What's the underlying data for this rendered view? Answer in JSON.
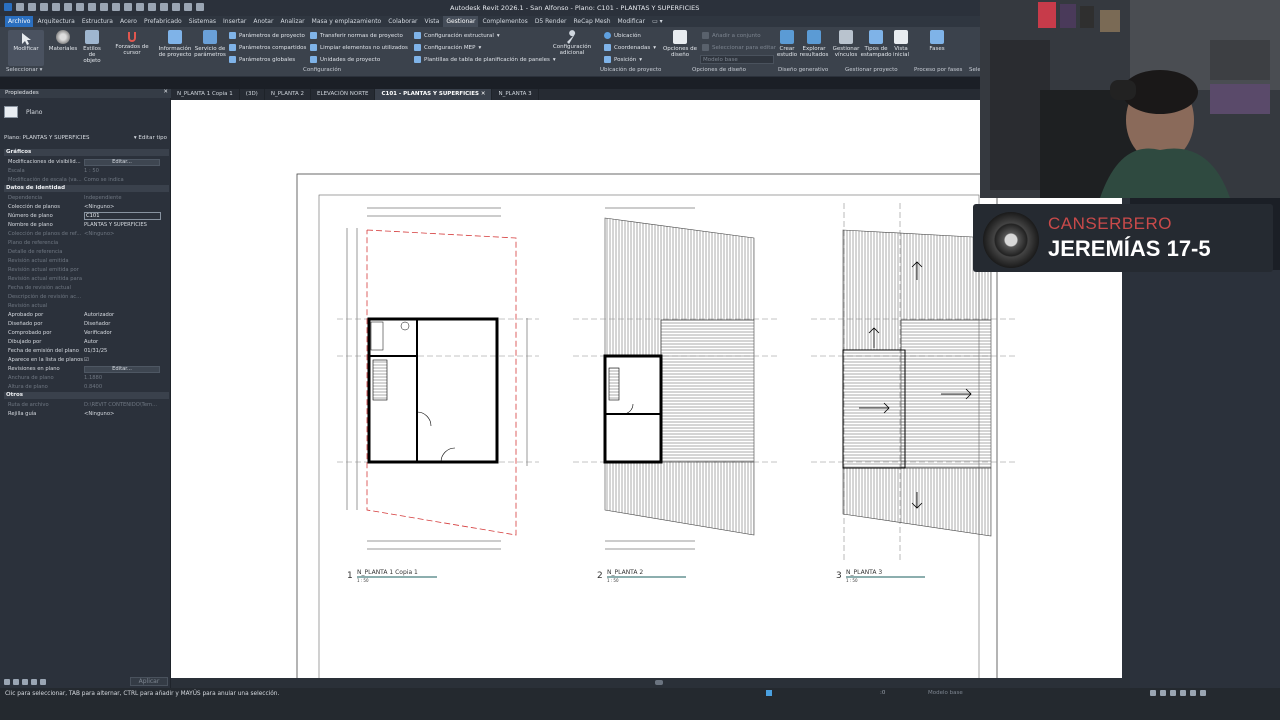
{
  "window_title": "Autodesk Revit 2026.1 - San Alfonso - Plano: C101 - PLANTAS Y SUPERFICIES",
  "menu_tabs": [
    "Archivo",
    "Arquitectura",
    "Estructura",
    "Acero",
    "Prefabricado",
    "Sistemas",
    "Insertar",
    "Anotar",
    "Analizar",
    "Masa y emplazamiento",
    "Colaborar",
    "Vista",
    "Gestionar",
    "Complementos",
    "D5 Render",
    "ReCap Mesh",
    "Modificar"
  ],
  "ribbon": {
    "modificar": "Modificar",
    "seleccionar": "Seleccionar",
    "materiales": "Materiales",
    "estilos_objeto": "Estilos de objeto",
    "forzados": "Forzados de cursor",
    "informacion": "Información de proyecto",
    "servicio": "Servicio de parámetros",
    "parametros_proyecto": "Parámetros de proyecto",
    "parametros_compartidos": "Parámetros compartidos",
    "parametros_globales": "Parámetros globales",
    "transferir": "Transferir normas de proyecto",
    "limpiar": "Limpiar elementos no utilizados",
    "unidades": "Unidades de proyecto",
    "config_estructural": "Configuración estructural",
    "config_mep": "Configuración MEP",
    "plantillas": "Plantillas de tabla de planificación de paneles",
    "configuracion": "Configuración",
    "config_adicional": "Configuración adicional",
    "ubicacion": "Ubicación",
    "coordenadas": "Coordenadas",
    "posicion": "Posición",
    "ubicacion_proyecto": "Ubicación de proyecto",
    "opciones_diseno_btn": "Opciones de diseño",
    "anadir_conjunto": "Añadir a conjunto",
    "seleccionar_edicion": "Seleccionar para editar",
    "modelo_base": "Modelo base",
    "opciones_diseno": "Opciones de diseño",
    "crear_estudio": "Crear estudio",
    "explorar": "Explorar resultados",
    "diseno_generativo": "Diseño generativo",
    "gestionar_vinculos": "Gestionar vínculos",
    "tipos_estampado": "Tipos de estampado",
    "vista_inicial": "Vista inicial",
    "gestionar_proyecto": "Gestionar proyecto",
    "fases": "Fases",
    "proceso_fases": "Proceso por fases",
    "sel": "Sele"
  },
  "properties": {
    "title": "Propiedades",
    "type_name": "Plano",
    "selector": "Plano: PLANTAS Y SUPERFICIES",
    "edit_type": "Editar tipo",
    "section_graficos": "Gráficos",
    "section_identidad": "Datos de identidad",
    "section_otros": "Otros",
    "graficos": [
      {
        "k": "Modificaciones de visibilid...",
        "v": "Editar...",
        "button": true
      },
      {
        "k": "Escala",
        "v": "1 : 50",
        "dim": true
      },
      {
        "k": "Modificación de escala (va...",
        "v": "Como se indica",
        "dim": true
      }
    ],
    "identidad": [
      {
        "k": "Dependencia",
        "v": "Independiente",
        "dim": true
      },
      {
        "k": "Colección de planos",
        "v": "<Ninguno>"
      },
      {
        "k": "Número de plano",
        "v": "C101",
        "box": true
      },
      {
        "k": "Nombre de plano",
        "v": "PLANTAS Y SUPERFICIES"
      },
      {
        "k": "Colección de planos de ref...",
        "v": "<Ninguno>",
        "dim": true
      },
      {
        "k": "Plano de referencia",
        "v": "",
        "dim": true
      },
      {
        "k": "Detalle de referencia",
        "v": "",
        "dim": true
      },
      {
        "k": "Revisión actual emitida",
        "v": "",
        "dim": true
      },
      {
        "k": "Revisión actual emitida por",
        "v": "",
        "dim": true
      },
      {
        "k": "Revisión actual emitida para",
        "v": "",
        "dim": true
      },
      {
        "k": "Fecha de revisión actual",
        "v": "",
        "dim": true
      },
      {
        "k": "Descripción de revisión ac...",
        "v": "",
        "dim": true
      },
      {
        "k": "Revisión actual",
        "v": "",
        "dim": true
      },
      {
        "k": "Aprobado por",
        "v": "Autorizador"
      },
      {
        "k": "Diseñado por",
        "v": "Diseñador"
      },
      {
        "k": "Comprobado por",
        "v": "Verificador"
      },
      {
        "k": "Dibujado por",
        "v": "Autor"
      },
      {
        "k": "Fecha de emisión del plano",
        "v": "01/31/25"
      },
      {
        "k": "Aparece en la lista de planos",
        "v": "☑"
      },
      {
        "k": "Revisiones en plano",
        "v": "Editar...",
        "button": true
      },
      {
        "k": "Anchura de plano",
        "v": "1.1880",
        "dim": true
      },
      {
        "k": "Altura de plano",
        "v": "0.8400",
        "dim": true
      }
    ],
    "otros": [
      {
        "k": "Ruta de archivo",
        "v": "D:\\REVIT CONTENIDO\\Tem...",
        "dim": true
      },
      {
        "k": "Rejilla guía",
        "v": "<Ninguno>"
      }
    ],
    "apply": "Aplicar"
  },
  "doc_tabs": [
    {
      "label": "N_PLANTA 1 Copia 1",
      "active": false
    },
    {
      "label": "(3D)",
      "active": false
    },
    {
      "label": "N_PLANTA 2",
      "active": false
    },
    {
      "label": "ELEVACIÓN NORTE",
      "active": false
    },
    {
      "label": "C101 - PLANTAS Y SUPERFICIES",
      "active": true
    },
    {
      "label": "N_PLANTA 3",
      "active": false
    }
  ],
  "viewports": [
    {
      "num": "1",
      "name": "N_PLANTA 1 Copia 1",
      "scale": "1 : 50"
    },
    {
      "num": "2",
      "name": "N_PLANTA 2",
      "scale": "1 : 50"
    },
    {
      "num": "3",
      "name": "N_PLANTA 3",
      "scale": "1 : 50"
    }
  ],
  "status": {
    "text": "Clic para seleccionar, TAB para alternar, CTRL para añadir y MAYÚS para anular una selección.",
    "model": "Modelo base",
    "zero": ":0"
  },
  "overlay": {
    "artist": "CANSERBERO",
    "song": "JEREMÍAS 17-5"
  },
  "colors": {
    "accent": "#2a6fc0",
    "panel": "#2b313b",
    "artist_red": "#c94a4a"
  }
}
